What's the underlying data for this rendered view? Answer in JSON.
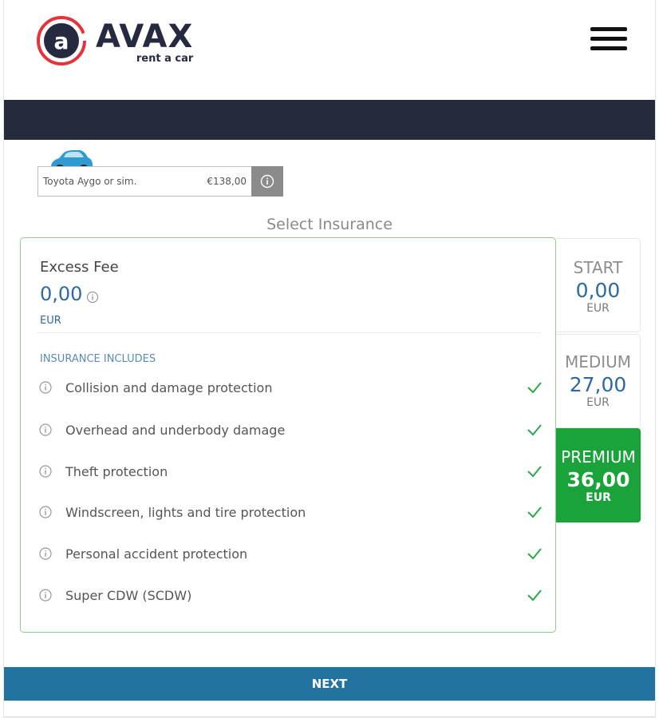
{
  "header": {
    "brand_mark": "a",
    "brand_name": "AVAX",
    "brand_tagline": "rent a car",
    "accent_color": "#e5333b",
    "brand_color": "#262a40",
    "menu_icon": "hamburger-menu-icon"
  },
  "car": {
    "name": "Toyota Aygo or sim.",
    "price": "€138,00",
    "info_icon": "info-icon"
  },
  "section_title": "Select Insurance",
  "selected_plan": {
    "excess_label": "Excess Fee",
    "excess_value": "0,00",
    "excess_currency": "EUR",
    "includes_heading": "INSURANCE INCLUDES",
    "features": [
      {
        "label": "Collision and damage protection",
        "included": true
      },
      {
        "label": "Overhead and underbody damage",
        "included": true
      },
      {
        "label": "Theft protection",
        "included": true
      },
      {
        "label": "Windscreen, lights and tire protection",
        "included": true
      },
      {
        "label": "Personal accident protection",
        "included": true
      },
      {
        "label": "Super CDW (SCDW)",
        "included": true
      }
    ]
  },
  "plans": [
    {
      "name": "START",
      "price": "0,00",
      "currency": "EUR",
      "selected": false
    },
    {
      "name": "MEDIUM",
      "price": "27,00",
      "currency": "EUR",
      "selected": false
    },
    {
      "name": "PREMIUM",
      "price": "36,00",
      "currency": "EUR",
      "selected": true
    }
  ],
  "colors": {
    "selected_plan": "#1aa23b",
    "price_blue": "#2d6aa1",
    "dark_band": "#252a3d",
    "next_button": "#22739f"
  },
  "next_label": "NEXT"
}
